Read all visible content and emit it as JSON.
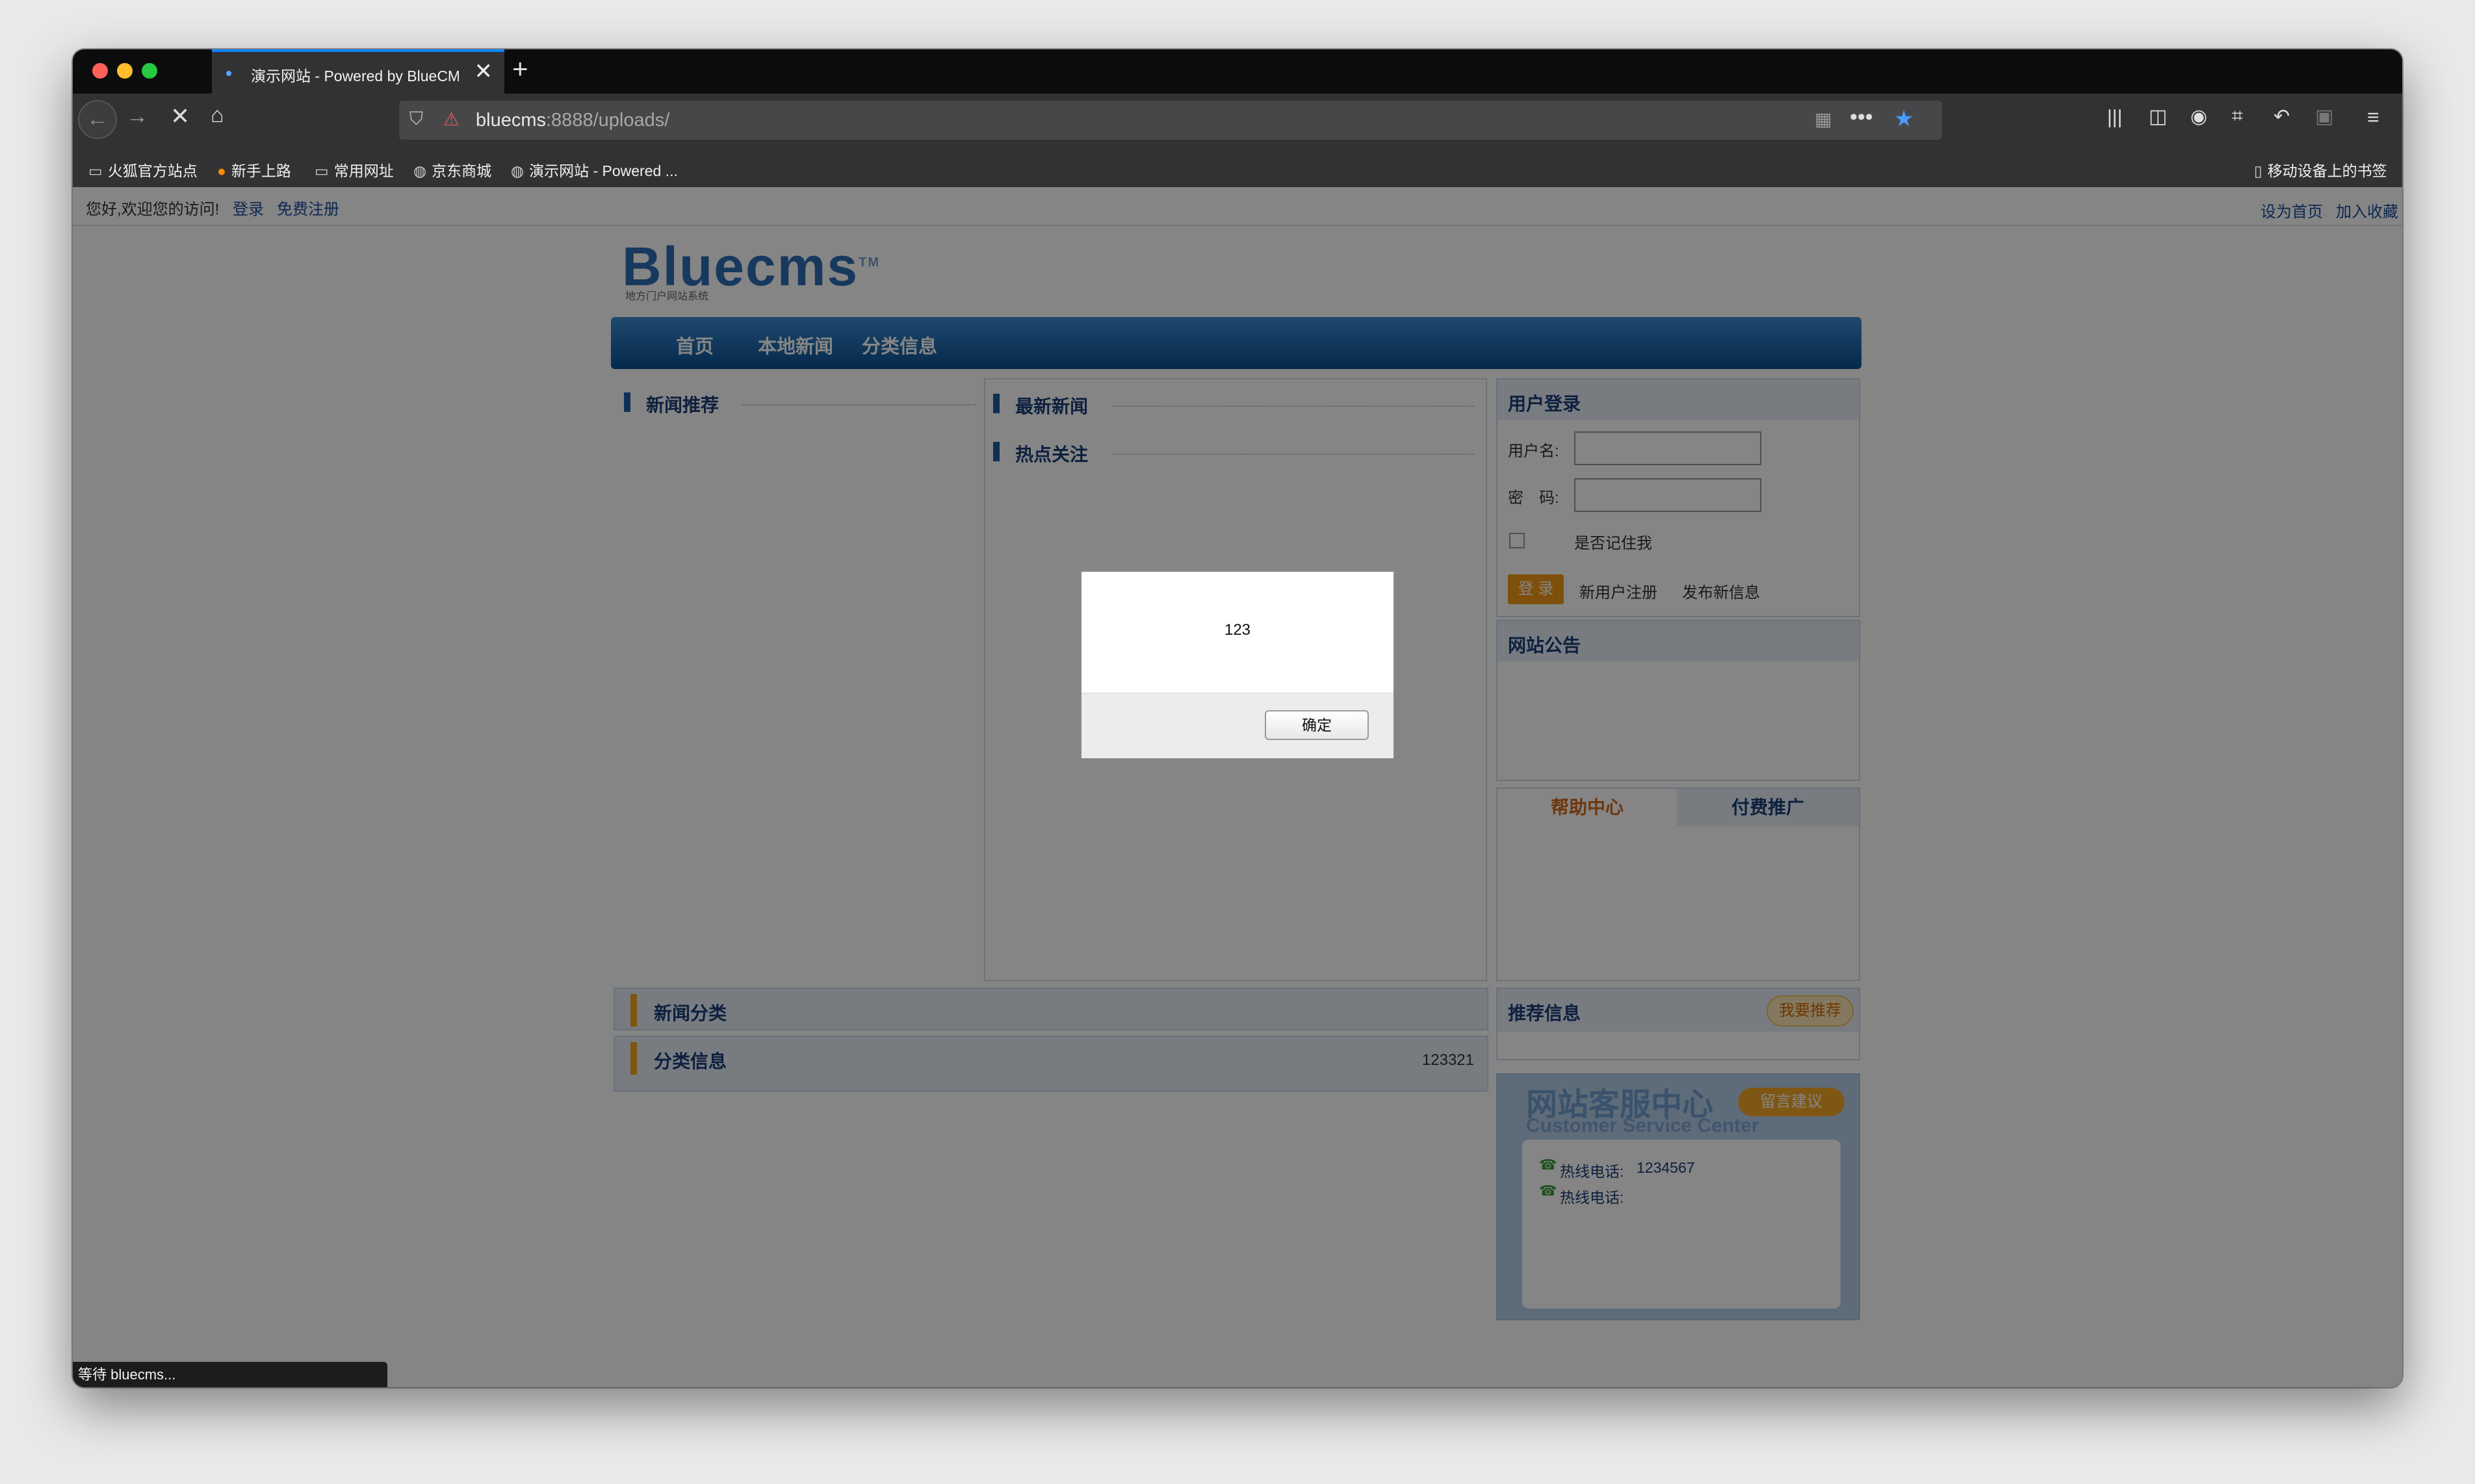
{
  "browser": {
    "tab_title": "演示网站 - Powered by BlueCMS",
    "url_host": "bluecms",
    "url_rest": ":8888/uploads/",
    "bookmarks": [
      "火狐官方站点",
      "新手上路",
      "常用网址",
      "京东商城",
      "演示网站 - Powered ..."
    ],
    "mobile_bookmarks": "移动设备上的书签",
    "status_text": "等待 bluecms..."
  },
  "topbar": {
    "welcome": "您好,欢迎您的访问!",
    "login": "登录",
    "register": "免费注册",
    "set_home": "设为首页",
    "add_fav": "加入收藏"
  },
  "site": {
    "logo": "Bluecms",
    "logo_tm": "TM",
    "logo_sub": "地方门户网站系统",
    "nav": [
      "首页",
      "本地新闻",
      "分类信息"
    ]
  },
  "sections": {
    "news_recommend": "新闻推荐",
    "latest_news": "最新新闻",
    "hot_focus": "热点关注",
    "news_category": "新闻分类",
    "classified": "分类信息",
    "classified_value": "123321"
  },
  "login_panel": {
    "title": "用户登录",
    "username_label": "用户名:",
    "password_label": "密　码:",
    "remember": "是否记住我",
    "login_btn": "登 录",
    "new_user": "新用户注册",
    "post_info": "发布新信息"
  },
  "notice": {
    "title": "网站公告"
  },
  "help_tabs": [
    "帮助中心",
    "付费推广"
  ],
  "recommend": {
    "title": "推荐信息",
    "button": "我要推荐"
  },
  "service": {
    "title_cn": "网站客服中心",
    "title_en": "Customer Service Center",
    "feedback": "留言建议",
    "hotline1_label": "热线电话:",
    "hotline1_value": "1234567",
    "hotline2_label": "热线电话:"
  },
  "dialog": {
    "message": "123",
    "ok": "确定"
  }
}
